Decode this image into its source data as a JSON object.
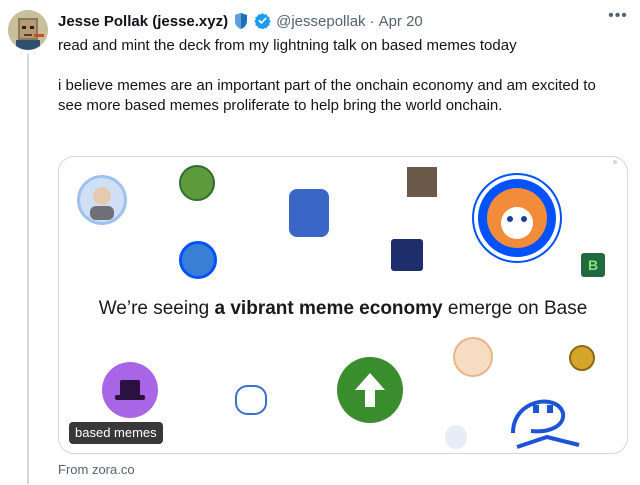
{
  "tweet": {
    "display_name": "Jesse Pollak (jesse.xyz)",
    "handle": "@jessepollak",
    "separator": "·",
    "date": "Apr 20",
    "more_icon": "more-horizontal-icon",
    "text_line_1": "read and mint the deck from my lightning talk on based memes today",
    "text_line_2": "i believe memes are an important part of the onchain economy and am excited to see more based memes proliferate to help bring the world onchain."
  },
  "card": {
    "headline_pre": "We’re seeing ",
    "headline_bold": "a vibrant meme economy",
    "headline_post": " emerge on Base",
    "badge_label": "based memes",
    "source": "From zora.co"
  },
  "colors": {
    "verified_blue": "#1d9bf0",
    "shield_blue": "#1d6fb8",
    "base_blue": "#0052ff",
    "arrow_green": "#3a8d2c",
    "purple_hat": "#a865e6"
  }
}
